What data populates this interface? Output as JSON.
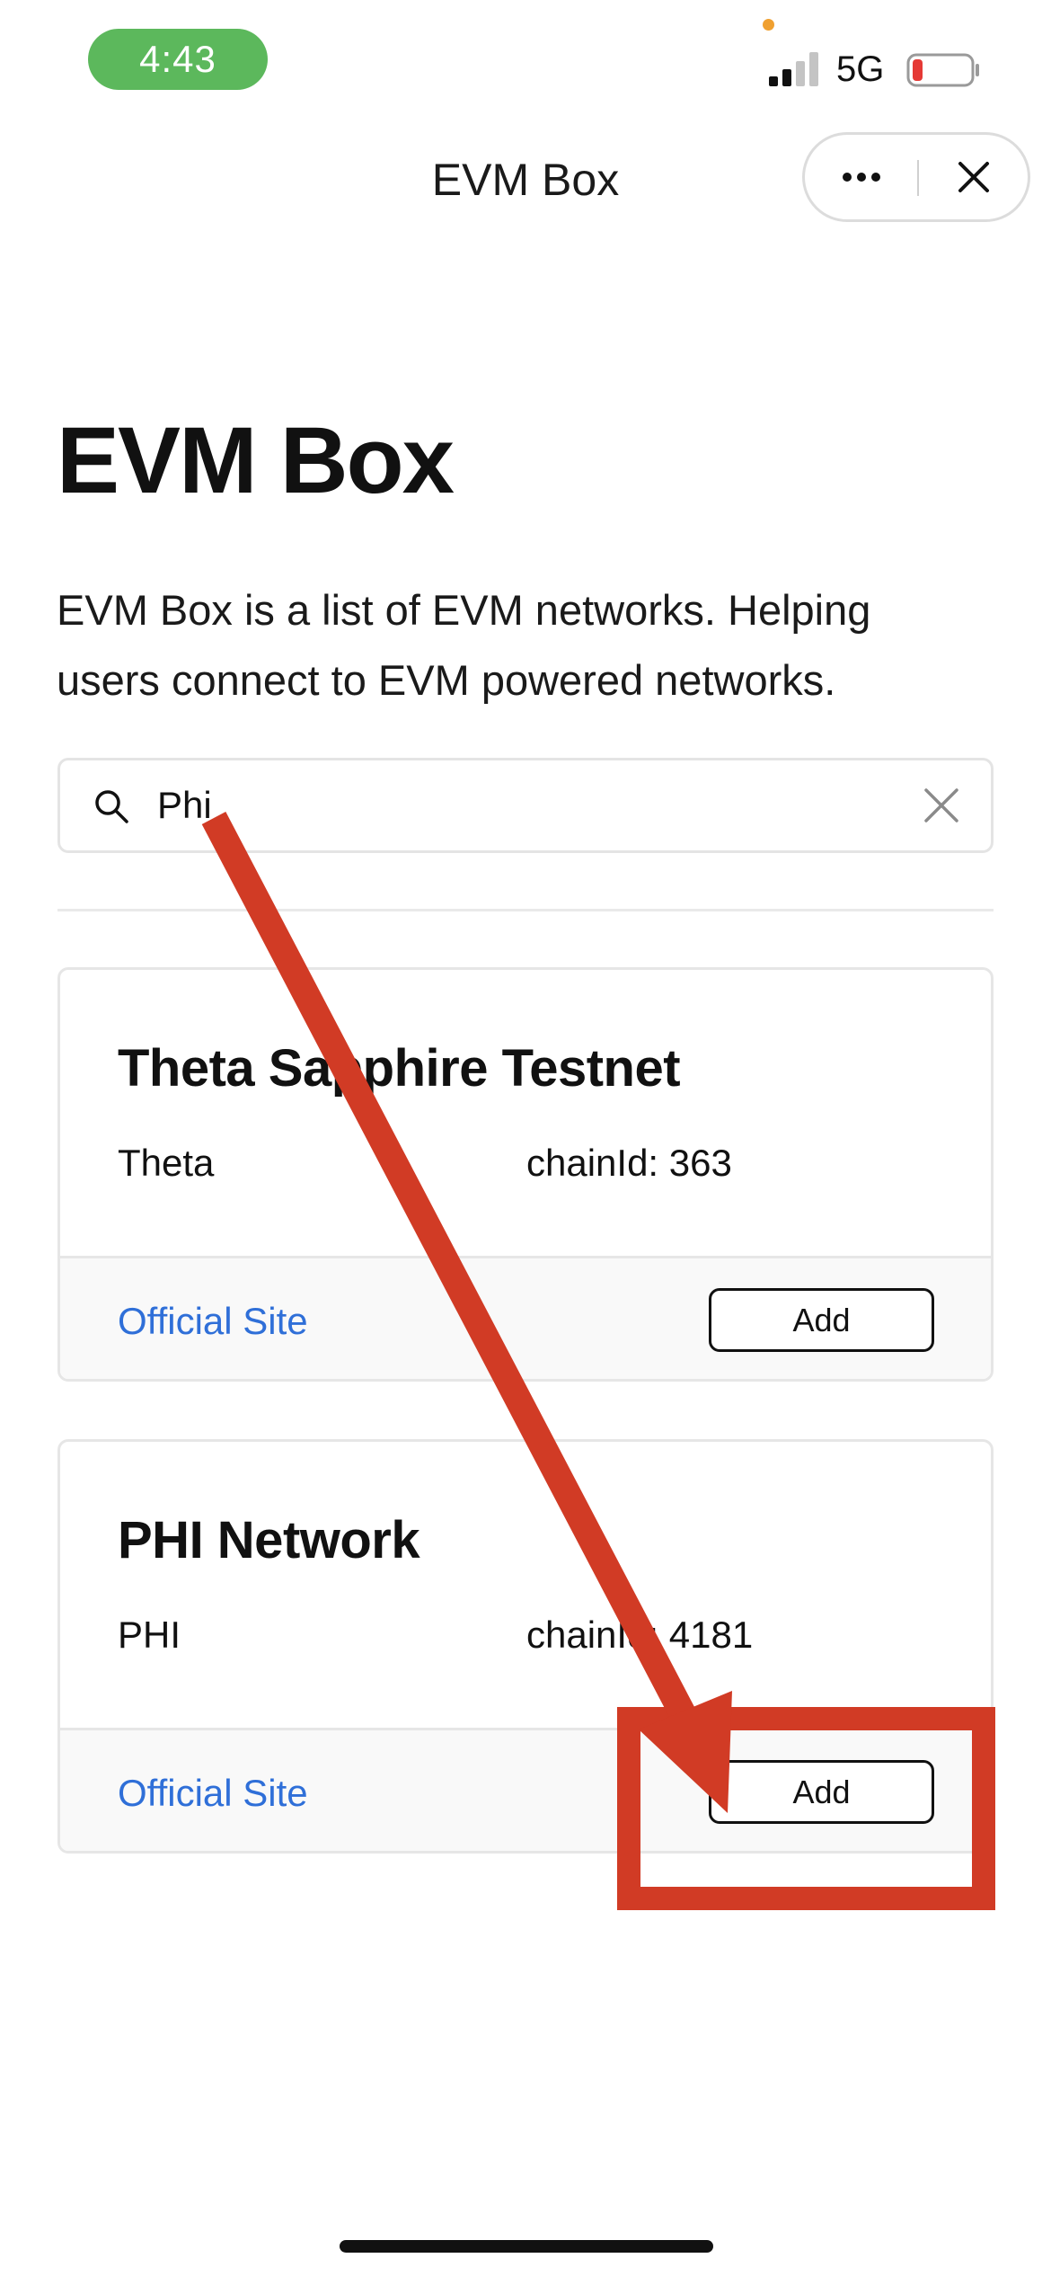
{
  "status_bar": {
    "time": "4:43",
    "network": "5G",
    "time_pill_color": "#5cb85c",
    "battery_level_color": "#e53935",
    "privacy_dot_color": "#f0a030",
    "icons": [
      "signal-icon",
      "battery-icon"
    ]
  },
  "nav": {
    "title": "EVM Box",
    "icons": [
      "more-icon",
      "close-icon"
    ]
  },
  "main": {
    "title": "EVM Box",
    "description": "EVM Box is a list of EVM networks. Helping users connect to EVM powered networks."
  },
  "search": {
    "value": "Phi",
    "placeholder": "",
    "icons": [
      "search-icon",
      "clear-icon"
    ]
  },
  "networks": [
    {
      "name": "Theta Sapphire Testnet",
      "symbol": "Theta",
      "chain_id": "chainId: 363",
      "link_label": "Official Site",
      "add_label": "Add"
    },
    {
      "name": "PHI Network",
      "symbol": "PHI",
      "chain_id": "chainId: 4181",
      "link_label": "Official Site",
      "add_label": "Add"
    }
  ],
  "colors": {
    "link": "#2f6fd8",
    "annotation": "#d13b25"
  }
}
